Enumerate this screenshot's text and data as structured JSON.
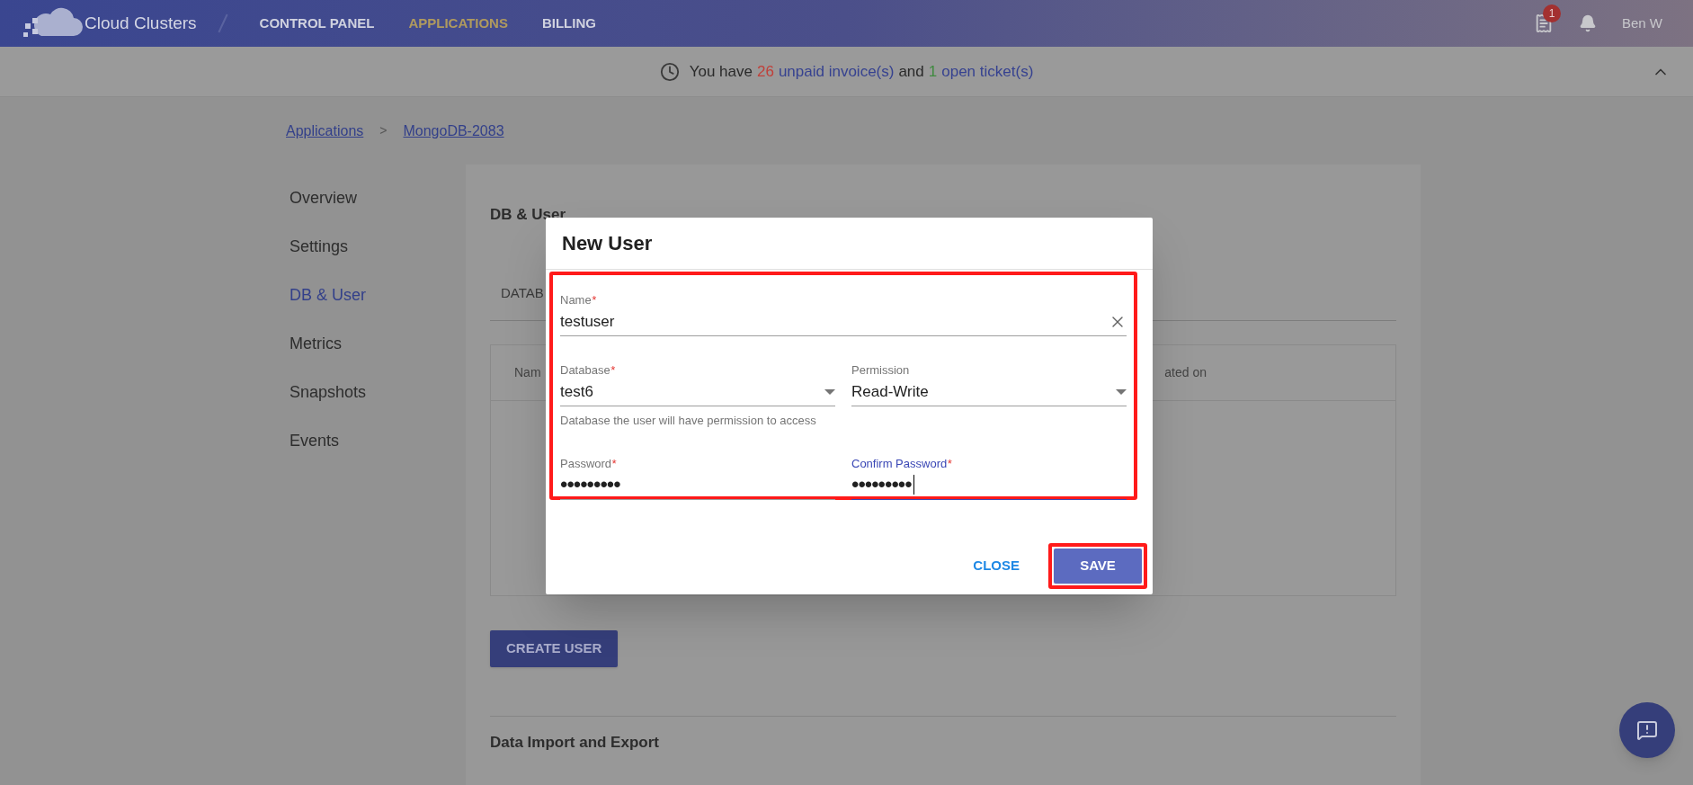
{
  "nav": {
    "brand": "Cloud Clusters",
    "links": [
      {
        "label": "CONTROL PANEL",
        "selected": false
      },
      {
        "label": "APPLICATIONS",
        "selected": true
      },
      {
        "label": "BILLING",
        "selected": false
      }
    ],
    "invoice_badge": "1",
    "user": "Ben W"
  },
  "notice": {
    "segments": [
      {
        "kind": "text",
        "text": "You have"
      },
      {
        "kind": "count",
        "text": "26",
        "color": "#c0403a"
      },
      {
        "kind": "link",
        "text": "unpaid invoice(s)"
      },
      {
        "kind": "text",
        "text": "and"
      },
      {
        "kind": "count",
        "text": "1",
        "color": "#3f8a3f"
      },
      {
        "kind": "link",
        "text": "open ticket(s)"
      }
    ]
  },
  "breadcrumb": {
    "items": [
      "Applications",
      "MongoDB-2083"
    ],
    "separator": ">"
  },
  "sidebar": {
    "items": [
      {
        "label": "Overview",
        "selected": false
      },
      {
        "label": "Settings",
        "selected": false
      },
      {
        "label": "DB & User",
        "selected": true
      },
      {
        "label": "Metrics",
        "selected": false
      },
      {
        "label": "Snapshots",
        "selected": false
      },
      {
        "label": "Events",
        "selected": false
      }
    ]
  },
  "content": {
    "heading": "DB & User",
    "tab": "DATAB",
    "table": {
      "columns": [
        "Nam",
        "ated on"
      ]
    },
    "create_button": "CREATE USER",
    "section_heading": "Data Import and Export"
  },
  "dialog": {
    "title": "New User",
    "fields": [
      {
        "kind": "text",
        "label": "Name",
        "required": true,
        "value": "testuser",
        "focused": false
      },
      {
        "kind": "select",
        "label": "Database",
        "required": true,
        "value": "test6",
        "focused": false,
        "hint": "Database the user will have permission to access"
      },
      {
        "kind": "select",
        "label": "Permission",
        "required": false,
        "value": "Read-Write",
        "focused": false
      },
      {
        "kind": "password",
        "label": "Password",
        "required": true,
        "value": "•••••••••",
        "focused": false
      },
      {
        "kind": "password",
        "label": "Confirm Password",
        "required": true,
        "value": "•••••••••",
        "focused": true
      }
    ],
    "required_mark": "*",
    "close_button": "CLOSE",
    "save_button": "SAVE"
  }
}
